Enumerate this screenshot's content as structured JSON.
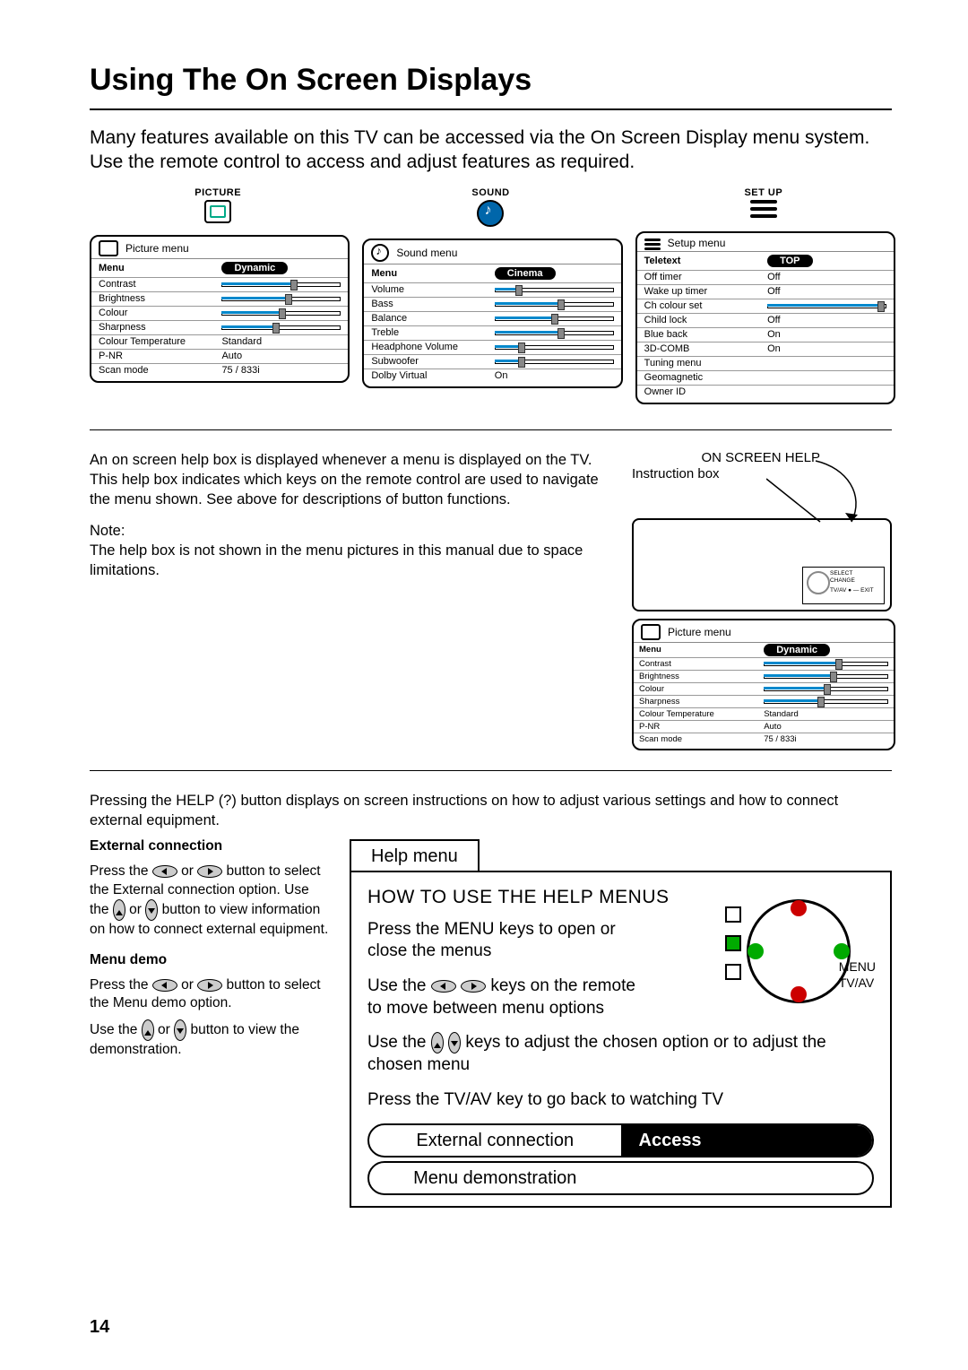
{
  "page": {
    "title": "Using The On Screen Displays",
    "intro": "Many features available on this TV can be accessed via the On Screen Display menu system. Use the remote control to access and adjust features as required.",
    "number": "14"
  },
  "menus": {
    "picture": {
      "category": "PICTURE",
      "title": "Picture menu",
      "header_l": "Menu",
      "header_r": "Dynamic",
      "rows": [
        {
          "label": "Contrast",
          "type": "slider",
          "value": 60
        },
        {
          "label": "Brightness",
          "type": "slider",
          "value": 55
        },
        {
          "label": "Colour",
          "type": "slider",
          "value": 50
        },
        {
          "label": "Sharpness",
          "type": "slider",
          "value": 45
        },
        {
          "label": "Colour Temperature",
          "type": "text",
          "value": "Standard"
        },
        {
          "label": "P-NR",
          "type": "text",
          "value": "Auto"
        },
        {
          "label": "Scan mode",
          "type": "text",
          "value": "75 / 833i"
        }
      ]
    },
    "sound": {
      "category": "SOUND",
      "title": "Sound menu",
      "header_l": "Menu",
      "header_r": "Cinema",
      "rows": [
        {
          "label": "Volume",
          "type": "slider",
          "value": 20
        },
        {
          "label": "Bass",
          "type": "slider",
          "value": 55
        },
        {
          "label": "Balance",
          "type": "slider",
          "value": 50
        },
        {
          "label": "Treble",
          "type": "slider",
          "value": 55
        },
        {
          "label": "Headphone Volume",
          "type": "slider",
          "value": 22
        },
        {
          "label": "Subwoofer",
          "type": "slider",
          "value": 22
        },
        {
          "label": "Dolby Virtual",
          "type": "text",
          "value": "On"
        }
      ]
    },
    "setup": {
      "category": "SET UP",
      "title": "Setup menu",
      "header_l": "Teletext",
      "header_r": "TOP",
      "rows": [
        {
          "label": "Off timer",
          "type": "text",
          "value": "Off"
        },
        {
          "label": "Wake up timer",
          "type": "text",
          "value": "Off"
        },
        {
          "label": "Ch colour set",
          "type": "slider",
          "value": 95
        },
        {
          "label": "Child lock",
          "type": "text",
          "value": "Off"
        },
        {
          "label": "Blue back",
          "type": "text",
          "value": "On"
        },
        {
          "label": "3D-COMB",
          "type": "text",
          "value": "On"
        },
        {
          "label": "Tuning menu",
          "type": "text",
          "value": ""
        },
        {
          "label": "Geomagnetic",
          "type": "text",
          "value": ""
        },
        {
          "label": "Owner ID",
          "type": "text",
          "value": ""
        }
      ]
    }
  },
  "help_section": {
    "para1": "An on screen help box is displayed whenever a menu is displayed on the TV. This help box indicates which keys on the remote control are used to navigate the menu shown. See above for descriptions of button functions.",
    "note_label": "Note:",
    "note": "The help box is not shown in the menu pictures in this manual due to space limitations.",
    "callout1": "ON SCREEN HELP",
    "callout2": "Instruction box",
    "helpbox_labels": {
      "a": "SELECT",
      "b": "CHANGE",
      "c": "TV/AV ● — EXIT"
    }
  },
  "section3_intro": "Pressing the HELP (?) button displays on screen instructions on how to adjust various settings and how to connect external equipment.",
  "ext_conn": {
    "title": "External connection",
    "line1a": "Press the ",
    "line1b": " or ",
    "line1c": " button to select the External connection option. Use the ",
    "line1d": " or ",
    "line1e": " button to view information on how to connect external equipment."
  },
  "menu_demo": {
    "title": "Menu demo",
    "line1a": "Press the ",
    "line1b": " or ",
    "line1c": " button to select the Menu demo option.",
    "line2a": "Use the ",
    "line2b": " or ",
    "line2c": " button to view the demonstration."
  },
  "helpmenu": {
    "tab": "Help menu",
    "title": "HOW TO USE THE HELP MENUS",
    "p1": "Press the MENU keys to open or close the menus",
    "p2a": "Use the ",
    "p2b": " keys on the remote to move between menu options",
    "p3a": "Use the ",
    "p3b": " keys to adjust the chosen option or to adjust the chosen menu",
    "p4": "Press the TV/AV key to go back to watching TV",
    "remote_labels": {
      "menu": "MENU",
      "tvav": "TV/AV"
    },
    "row1_l": "External connection",
    "row1_r": "Access",
    "row2": "Menu demonstration"
  }
}
